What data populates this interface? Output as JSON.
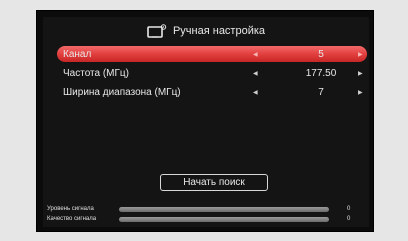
{
  "header": {
    "title": "Ручная настройка",
    "icon": "tv-settings-icon"
  },
  "rows": [
    {
      "label": "Канал",
      "value": "5",
      "selected": true
    },
    {
      "label": "Частота (МГц)",
      "value": "177.50",
      "selected": false
    },
    {
      "label": "Ширина диапазона (МГц)",
      "value": "7",
      "selected": false
    }
  ],
  "arrows": {
    "left": "◀",
    "right": "▶"
  },
  "search_button": {
    "label": "Начать поиск"
  },
  "signal": {
    "level": {
      "label": "Уровень сигнала",
      "value": "0",
      "fill_fraction": 0
    },
    "quality": {
      "label": "Качество сигнала",
      "value": "0",
      "fill_fraction": 0
    }
  },
  "colors": {
    "selected_row": "#e2403f",
    "background": "#141414",
    "text": "#e8e8e8"
  }
}
